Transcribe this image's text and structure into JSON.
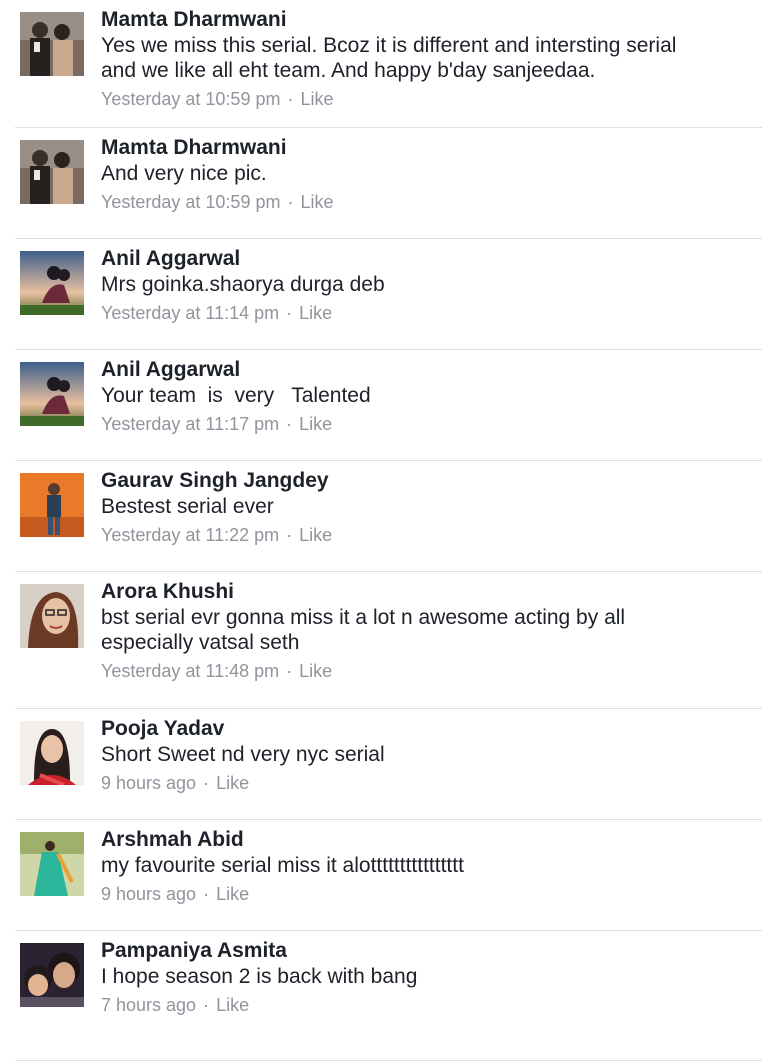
{
  "comments": [
    {
      "author": "Mamta Dharmwani",
      "text": [
        "Yes we miss this serial. Bcoz it is different and intersting serial",
        "and we like all eht team. And happy b'day sanjeedaa."
      ],
      "time": "Yesterday at 10:59 pm",
      "like": "Like",
      "avatar": "couple-photo"
    },
    {
      "author": "Mamta Dharmwani",
      "text": [
        "And very nice pic."
      ],
      "time": "Yesterday at 10:59 pm",
      "like": "Like",
      "avatar": "couple-photo"
    },
    {
      "author": "Anil Aggarwal",
      "text": [
        "Mrs goinka.shaorya durga deb"
      ],
      "time": "Yesterday at 11:14 pm",
      "like": "Like",
      "avatar": "sunset-couple-photo"
    },
    {
      "author": "Anil Aggarwal",
      "text": [
        "Your team  is  very   Talented"
      ],
      "time": "Yesterday at 11:17 pm",
      "like": "Like",
      "avatar": "sunset-couple-photo"
    },
    {
      "author": "Gaurav Singh Jangdey",
      "text": [
        "Bestest serial ever"
      ],
      "time": "Yesterday at 11:22 pm",
      "like": "Like",
      "avatar": "man-orange-photo"
    },
    {
      "author": "Arora Khushi",
      "text": [
        "bst serial evr gonna miss it a lot n awesome acting by all",
        "especially vatsal seth"
      ],
      "time": "Yesterday at 11:48 pm",
      "like": "Like",
      "avatar": "woman-glasses-photo"
    },
    {
      "author": "Pooja Yadav",
      "text": [
        "Short Sweet nd very nyc serial"
      ],
      "time": "9 hours ago",
      "like": "Like",
      "avatar": "woman-red-photo"
    },
    {
      "author": "Arshmah Abid",
      "text": [
        "my favourite serial miss it alotttttttttttttttt"
      ],
      "time": "9 hours ago",
      "like": "Like",
      "avatar": "woman-green-dress-photo"
    },
    {
      "author": "Pampaniya Asmita",
      "text": [
        "I hope season 2 is back with bang"
      ],
      "time": "7 hours ago",
      "like": "Like",
      "avatar": "mother-child-photo"
    }
  ],
  "separator": "·",
  "colors": {
    "name": "#1d2129",
    "meta": "#90949c",
    "divider": "#dddfe2"
  }
}
